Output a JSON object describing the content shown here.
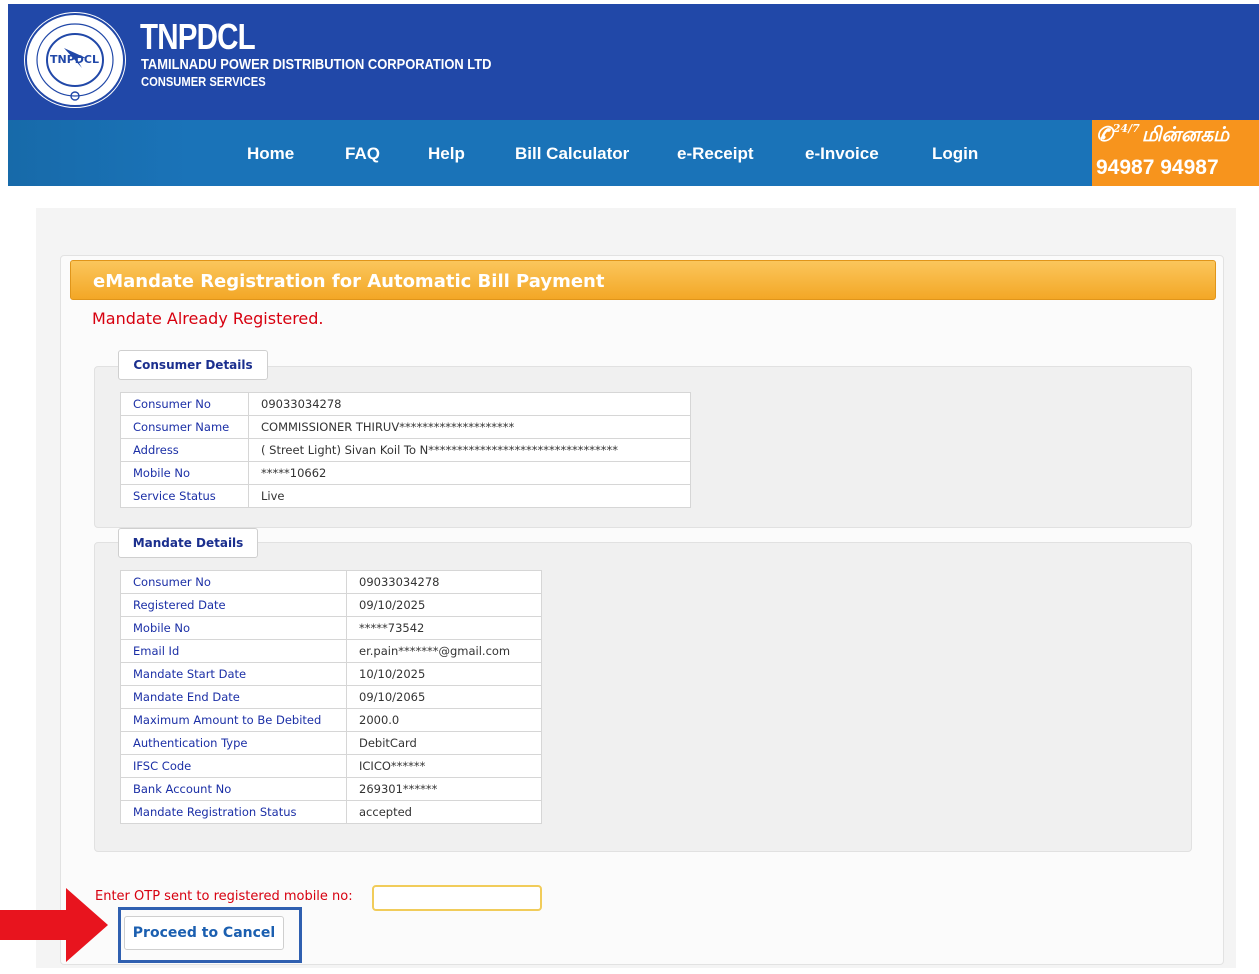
{
  "colors": {
    "header_bg": "#2148a8",
    "nav_bg": "#1a73b8",
    "helpline_bg": "#f7941d",
    "title_bar": "#f3a726",
    "error_red": "#d7000f",
    "label_blue": "#1b2fa6",
    "annotation_arrow": "#e8141e"
  },
  "header": {
    "logo_text": "TNPDCL",
    "title": "TNPDCL",
    "subtitle": "TAMILNADU POWER DISTRIBUTION CORPORATION LTD",
    "subtitle2": "CONSUMER SERVICES"
  },
  "nav": {
    "items": [
      "Home",
      "FAQ",
      "Help",
      "Bill Calculator",
      "e-Receipt",
      "e-Invoice",
      "Login"
    ]
  },
  "helpline": {
    "badge": "24/7",
    "text": "மின்னகம்",
    "phone": "94987 94987"
  },
  "page": {
    "title": "eMandate Registration for Automatic Bill Payment",
    "status_message": "Mandate Already Registered."
  },
  "consumer_details": {
    "legend": "Consumer Details",
    "rows": [
      {
        "label": "Consumer No",
        "value": "09033034278"
      },
      {
        "label": "Consumer Name",
        "value": "COMMISSIONER THIRUV********************"
      },
      {
        "label": "Address",
        "value": "( Street Light) Sivan Koil To N*********************************"
      },
      {
        "label": "Mobile No",
        "value": "*****10662"
      },
      {
        "label": "Service Status",
        "value": "Live"
      }
    ]
  },
  "mandate_details": {
    "legend": "Mandate Details",
    "rows": [
      {
        "label": "Consumer No",
        "value": "09033034278"
      },
      {
        "label": "Registered Date",
        "value": "09/10/2025"
      },
      {
        "label": "Mobile No",
        "value": "*****73542"
      },
      {
        "label": "Email Id",
        "value": "er.pain*******@gmail.com"
      },
      {
        "label": "Mandate Start Date",
        "value": "10/10/2025"
      },
      {
        "label": "Mandate End Date",
        "value": "09/10/2065"
      },
      {
        "label": "Maximum Amount to Be Debited",
        "value": "2000.0"
      },
      {
        "label": "Authentication Type",
        "value": "DebitCard"
      },
      {
        "label": "IFSC Code",
        "value": "ICICO******"
      },
      {
        "label": "Bank Account No",
        "value": "269301******"
      },
      {
        "label": "Mandate Registration Status",
        "value": "accepted"
      }
    ]
  },
  "otp": {
    "label": "Enter OTP sent to registered mobile no:",
    "value": ""
  },
  "actions": {
    "proceed_label": "Proceed to Cancel"
  }
}
